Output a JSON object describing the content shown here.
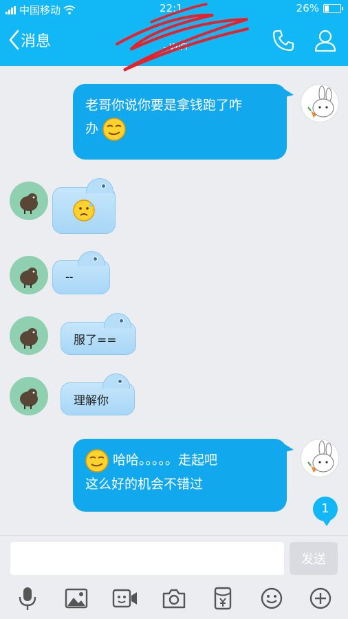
{
  "status_bar": {
    "carrier": "中国移动",
    "time": "22:1",
    "battery": "26%"
  },
  "header": {
    "back_label": "消息",
    "contact_name": "",
    "contact_status": "- WiFi"
  },
  "messages": [
    {
      "side": "out",
      "text_lines": [
        "老哥你说你要是拿钱跑了咋",
        "办"
      ],
      "emoji": "sly-smile-emoji"
    },
    {
      "side": "in",
      "text": "",
      "emoji": "sweat-emoji"
    },
    {
      "side": "in",
      "text": "--"
    },
    {
      "side": "in",
      "text": "服了=="
    },
    {
      "side": "in",
      "text": "理解你"
    },
    {
      "side": "out",
      "text_lines": [
        "哈哈。。。。。走起吧",
        "这么好的机会不错过"
      ],
      "emoji": "sly-smile-emoji"
    }
  ],
  "unread_count": "1",
  "composer": {
    "placeholder": "",
    "send_label": "发送"
  },
  "toolbar": [
    "mic-icon",
    "image-icon",
    "video-icon",
    "camera-icon",
    "red-packet-icon",
    "emoji-icon",
    "plus-icon"
  ],
  "colors": {
    "header": "#12b7f5",
    "outgoing_bubble": "#12a8ee",
    "incoming_bubble": "#b7def8",
    "background": "#ecedf1"
  }
}
